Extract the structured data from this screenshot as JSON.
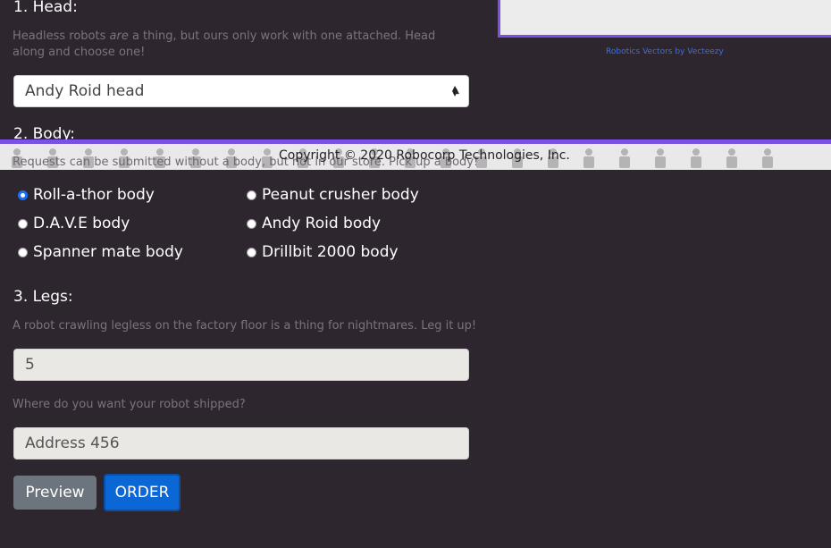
{
  "head": {
    "title": "1. Head:",
    "help_before": "Headless robots ",
    "help_em": "are",
    "help_after": " a thing, but ours only work with one attached. Head along and choose one!",
    "selected": "Andy Roid head"
  },
  "credit": "Robotics Vectors by Vecteezy",
  "footer": {
    "copyright": "Copyright © 2020 Robocorp Technologies, Inc."
  },
  "body": {
    "title": "2. Body:",
    "help": "Requests can be submitted without a body, but not in our store. Pick up a body!",
    "options": [
      {
        "label": "Roll-a-thor body",
        "checked": true
      },
      {
        "label": "Peanut crusher body",
        "checked": false
      },
      {
        "label": "D.A.V.E body",
        "checked": false
      },
      {
        "label": "Andy Roid body",
        "checked": false
      },
      {
        "label": "Spanner mate body",
        "checked": false
      },
      {
        "label": "Drillbit 2000 body",
        "checked": false
      }
    ]
  },
  "legs": {
    "title": "3. Legs:",
    "help": "A robot crawling legless on the factory floor is a thing for nightmares. Leg it up!",
    "value": "5"
  },
  "address": {
    "help": "Where do you want your robot shipped?",
    "value": "Address 456"
  },
  "buttons": {
    "preview": "Preview",
    "order": "ORDER"
  },
  "colors": {
    "background": "#2e262f",
    "accent_purple": "#7a50e6",
    "primary_blue": "#0b66d6",
    "secondary_gray": "#6c757d"
  }
}
